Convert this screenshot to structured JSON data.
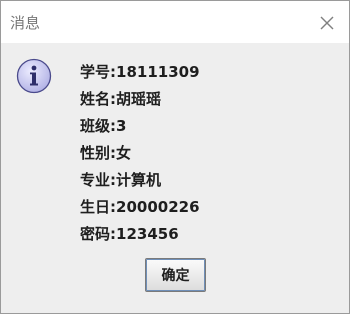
{
  "dialog": {
    "title": "消息",
    "icon": "info-icon",
    "close_icon": "close-icon",
    "lines": [
      {
        "label": "学号",
        "sep": ":",
        "value": "18111309"
      },
      {
        "label": "姓名",
        "sep": ":",
        "value": "胡瑶瑶"
      },
      {
        "label": "班级",
        "sep": ":",
        "value": "3"
      },
      {
        "label": "性别",
        "sep": ":",
        "value": "女"
      },
      {
        "label": "专业",
        "sep": ":",
        "value": "计算机"
      },
      {
        "label": "生日",
        "sep": ":",
        "value": "20000226"
      },
      {
        "label": "密码",
        "sep": ":",
        "value": "123456"
      }
    ],
    "ok_label": "确定"
  },
  "colors": {
    "title_bar": "#ffffff",
    "dialog_bg": "#eeeeee",
    "icon_fill": "#c9c9f2",
    "icon_stroke": "#4a4a8c"
  }
}
